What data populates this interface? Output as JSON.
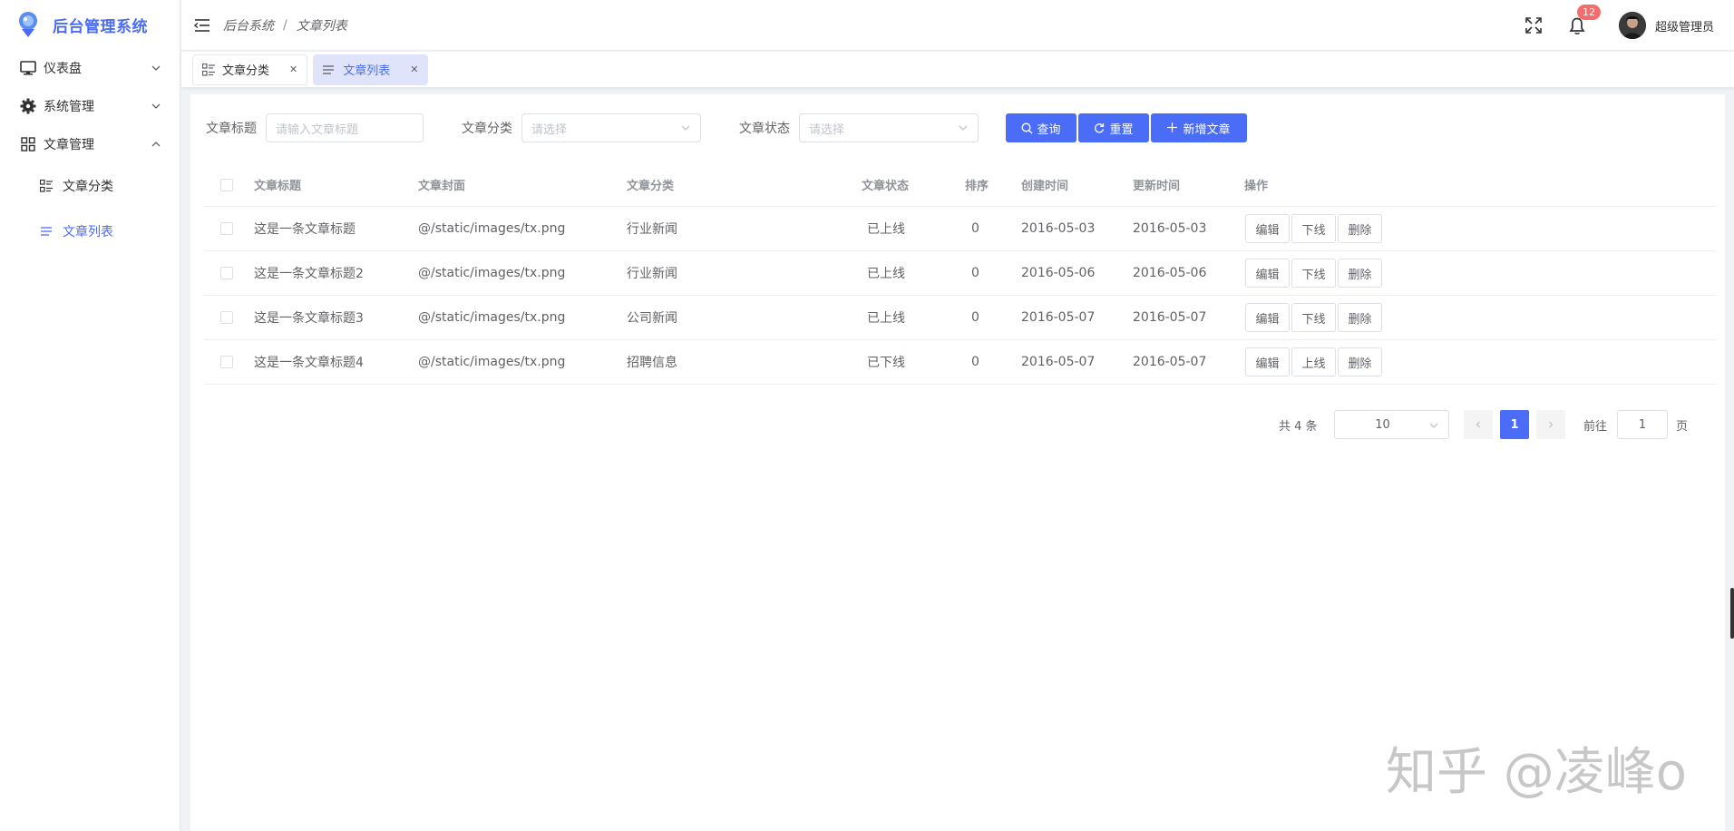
{
  "app": {
    "title": "后台管理系统"
  },
  "sidebar": {
    "items": [
      {
        "label": "仪表盘",
        "icon": "monitor-icon",
        "expanded": false
      },
      {
        "label": "系统管理",
        "icon": "gear-icon",
        "expanded": false
      },
      {
        "label": "文章管理",
        "icon": "grid-icon",
        "expanded": true
      }
    ],
    "subitems": [
      {
        "label": "文章分类",
        "icon": "category-icon",
        "active": false
      },
      {
        "label": "文章列表",
        "icon": "list-icon",
        "active": true
      }
    ]
  },
  "header": {
    "breadcrumb": [
      "后台系统",
      "文章列表"
    ],
    "notification_count": "12",
    "user_name": "超级管理员"
  },
  "tabs": [
    {
      "label": "文章分类",
      "active": false
    },
    {
      "label": "文章列表",
      "active": true
    }
  ],
  "filters": {
    "title_label": "文章标题",
    "title_placeholder": "请输入文章标题",
    "category_label": "文章分类",
    "category_placeholder": "请选择",
    "status_label": "文章状态",
    "status_placeholder": "请选择",
    "search_button": "查询",
    "reset_button": "重置",
    "add_button": "新增文章"
  },
  "table": {
    "columns": [
      "文章标题",
      "文章封面",
      "文章分类",
      "文章状态",
      "排序",
      "创建时间",
      "更新时间",
      "操作"
    ],
    "rows": [
      {
        "title": "这是一条文章标题",
        "cover": "@/static/images/tx.png",
        "category": "行业新闻",
        "status": "已上线",
        "sort": "0",
        "created": "2016-05-03",
        "updated": "2016-05-03",
        "actions": [
          "编辑",
          "下线",
          "删除"
        ]
      },
      {
        "title": "这是一条文章标题2",
        "cover": "@/static/images/tx.png",
        "category": "行业新闻",
        "status": "已上线",
        "sort": "0",
        "created": "2016-05-06",
        "updated": "2016-05-06",
        "actions": [
          "编辑",
          "下线",
          "删除"
        ]
      },
      {
        "title": "这是一条文章标题3",
        "cover": "@/static/images/tx.png",
        "category": "公司新闻",
        "status": "已上线",
        "sort": "0",
        "created": "2016-05-07",
        "updated": "2016-05-07",
        "actions": [
          "编辑",
          "下线",
          "删除"
        ]
      },
      {
        "title": "这是一条文章标题4",
        "cover": "@/static/images/tx.png",
        "category": "招聘信息",
        "status": "已下线",
        "sort": "0",
        "created": "2016-05-07",
        "updated": "2016-05-07",
        "actions": [
          "编辑",
          "上线",
          "删除"
        ]
      }
    ]
  },
  "pagination": {
    "total_text": "共 4 条",
    "page_size": "10",
    "current_page": "1",
    "goto_label": "前往",
    "goto_value": "1",
    "page_unit": "页"
  },
  "watermark": "知乎 @凌峰o",
  "colors": {
    "accent": "#4a6cf7",
    "badge": "#f56c6c"
  }
}
